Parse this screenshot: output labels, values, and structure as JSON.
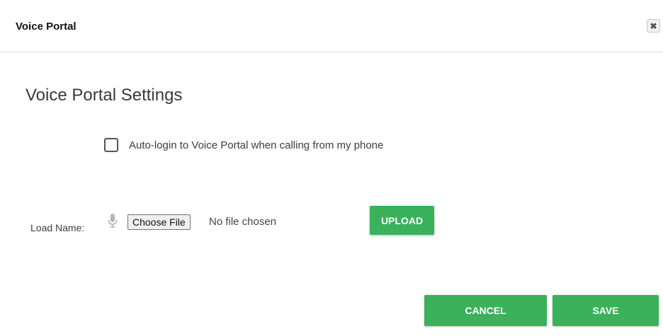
{
  "dialog": {
    "title": "Voice Portal",
    "close_icon": "close-icon",
    "close_glyph": "✖"
  },
  "settings": {
    "heading": "Voice Portal Settings",
    "auto_login_label": "Auto-login to Voice Portal when calling from my phone",
    "auto_login_checked": false
  },
  "load": {
    "label": "Load Name:",
    "mic_icon": "microphone-icon",
    "choose_file_label": "Choose File",
    "file_status": "No file chosen",
    "upload_label": "UPLOAD"
  },
  "footer": {
    "cancel_label": "CANCEL",
    "save_label": "SAVE"
  },
  "colors": {
    "accent": "#3ab15a",
    "header_border": "#d9d9d9"
  }
}
